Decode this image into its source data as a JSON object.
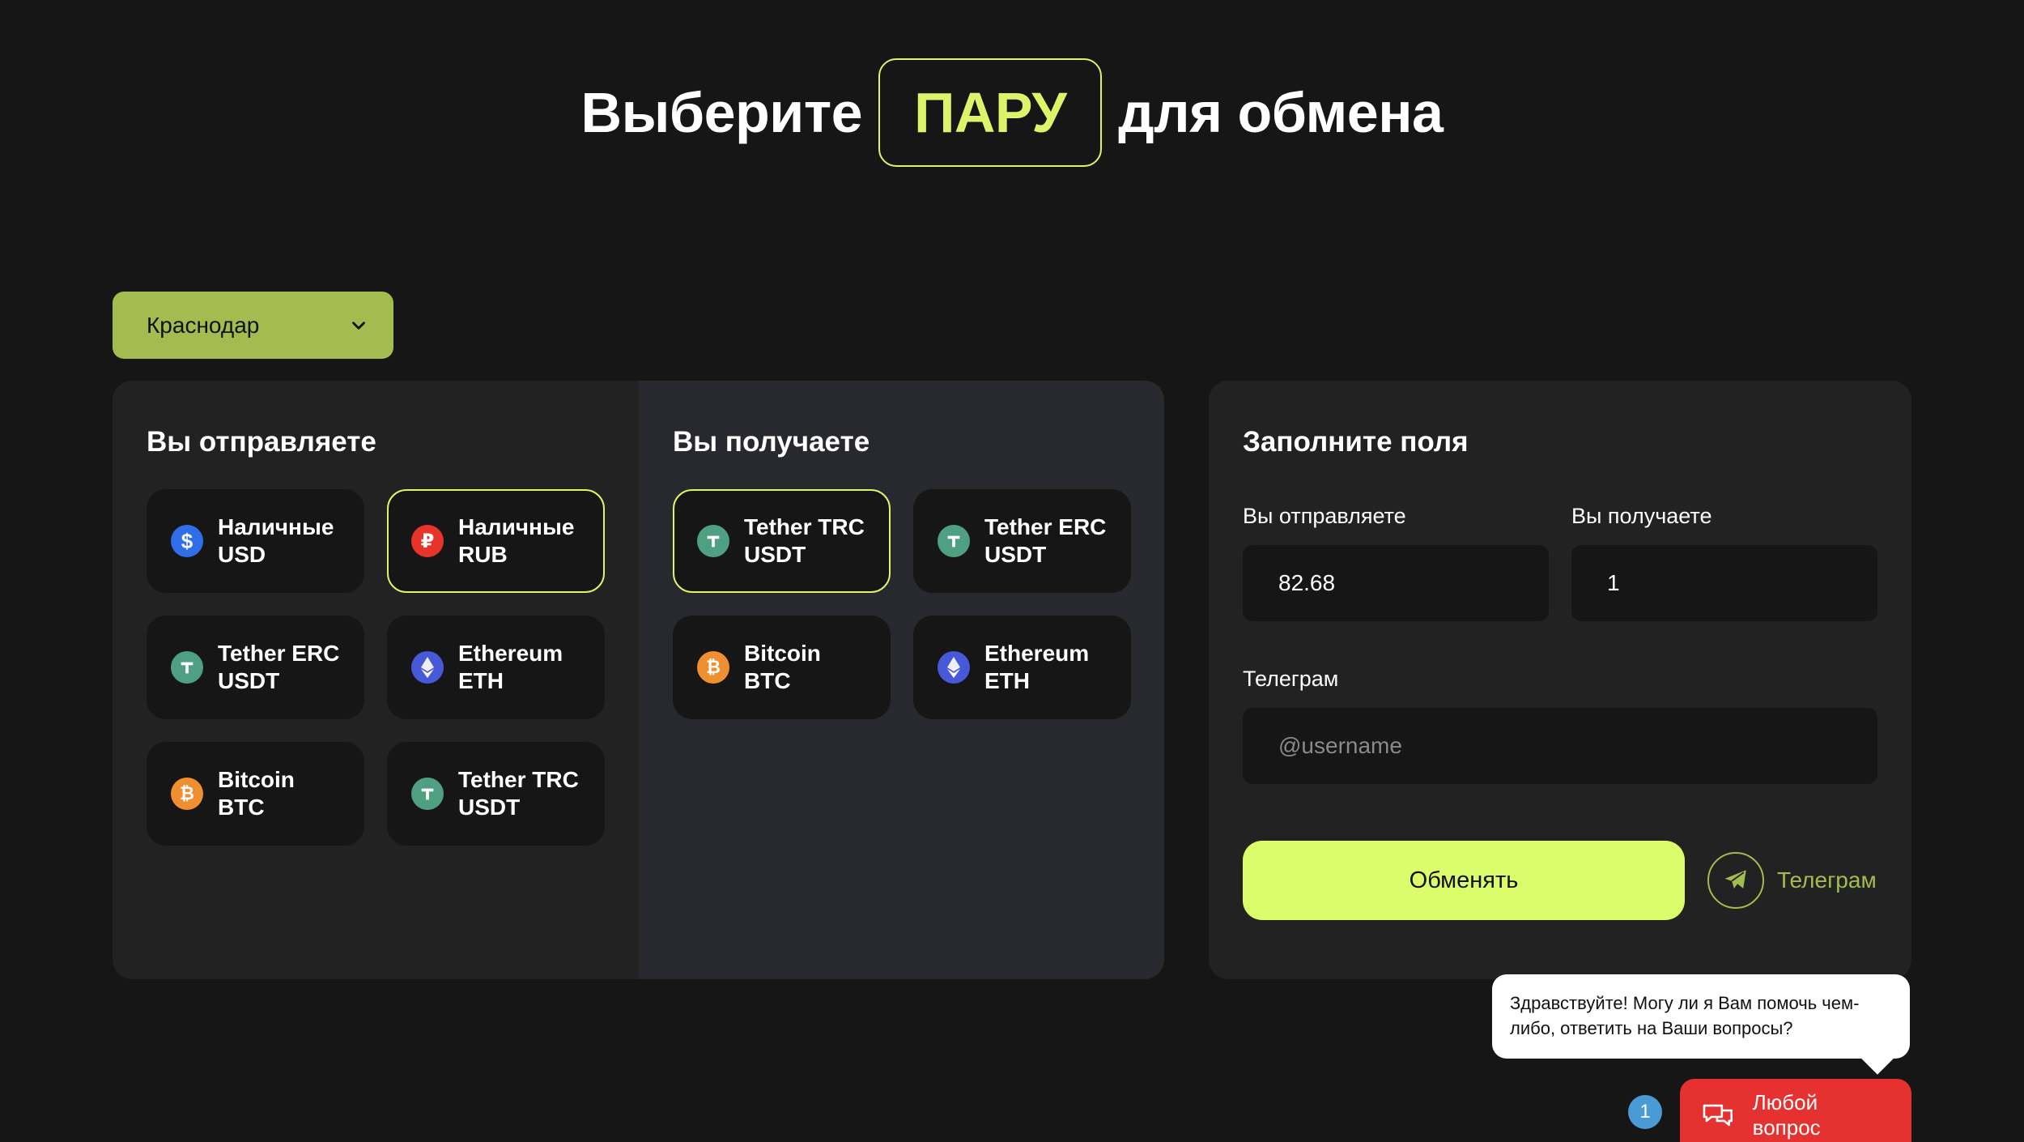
{
  "header": {
    "title_before": "Выберите",
    "title_highlight": "ПАРУ",
    "title_after": "для обмена"
  },
  "city": {
    "selected": "Краснодар",
    "icon": "chevron-down-icon"
  },
  "send": {
    "heading": "Вы отправляете",
    "items": [
      {
        "label": "Наличные\nUSD",
        "icon": "dollar-icon",
        "color": "#2f6ee8",
        "active": false
      },
      {
        "label": "Наличные\nRUB",
        "icon": "ruble-icon",
        "color": "#e8332b",
        "active": true
      },
      {
        "label": "Tether ERC\nUSDT",
        "icon": "tether-icon",
        "color": "#4f9f83",
        "active": false
      },
      {
        "label": "Ethereum\nETH",
        "icon": "ethereum-icon",
        "color": "#4759d8",
        "active": false
      },
      {
        "label": "Bitcoin BTC",
        "icon": "bitcoin-icon",
        "color": "#ef8f2f",
        "active": false
      },
      {
        "label": "Tether TRC\nUSDT",
        "icon": "tether-icon",
        "color": "#4f9f83",
        "active": false
      }
    ]
  },
  "receive": {
    "heading": "Вы получаете",
    "items": [
      {
        "label": "Tether TRC\nUSDT",
        "icon": "tether-icon",
        "color": "#4f9f83",
        "active": true
      },
      {
        "label": "Tether ERC\nUSDT",
        "icon": "tether-icon",
        "color": "#4f9f83",
        "active": false
      },
      {
        "label": "Bitcoin BTC",
        "icon": "bitcoin-icon",
        "color": "#ef8f2f",
        "active": false
      },
      {
        "label": "Ethereum\nETH",
        "icon": "ethereum-icon",
        "color": "#4759d8",
        "active": false
      }
    ]
  },
  "form": {
    "heading": "Заполните поля",
    "send_label": "Вы отправляете",
    "send_value": "82.68",
    "receive_label": "Вы получаете",
    "receive_value": "1",
    "telegram_label": "Телеграм",
    "telegram_placeholder": "@username",
    "submit": "Обменять",
    "telegram_link": "Телеграм"
  },
  "chat": {
    "message": "Здравствуйте! Могу ли я Вам помочь чем-либо, ответить на Ваши вопросы?",
    "badge": "1",
    "button": "Любой вопрос"
  },
  "colors": {
    "accent": "#dcf46a",
    "accent_dark": "#a3bc50",
    "chat": "#e5312f"
  }
}
